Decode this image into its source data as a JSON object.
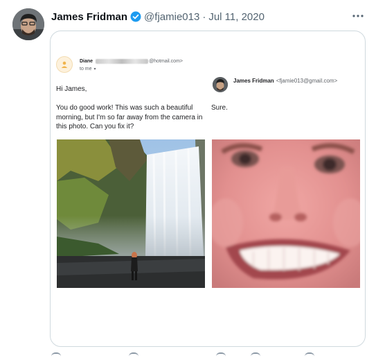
{
  "tweet": {
    "author_name": "James Fridman",
    "handle": "@fjamie013",
    "separator": "·",
    "date": "Jul 11, 2020",
    "more_icon": "ellipsis-icon",
    "verified_icon": "verified-badge-icon",
    "accent_color": "#1d9bf0"
  },
  "email_left": {
    "sender_first": "Diane",
    "sender_domain": "@hotmail.com>",
    "recipient": "to me",
    "greeting": "Hi James,",
    "body": "You do good work! This was such a beautiful morning, but I'm so far away from the camera in this photo. Can you fix it?"
  },
  "email_right": {
    "sender_name": "James Fridman",
    "sender_address": "<fjamie013@gmail.com>",
    "body": "Sure."
  },
  "actions": [
    "reply-icon",
    "retweet-icon",
    "like-icon",
    "views-icon",
    "share-icon"
  ]
}
